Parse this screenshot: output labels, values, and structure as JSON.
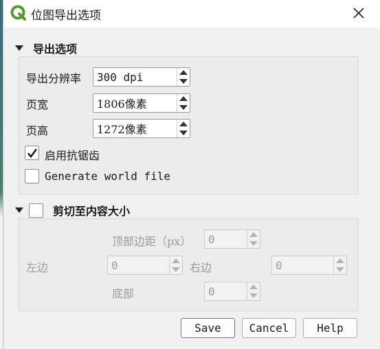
{
  "window": {
    "title": "位图导出选项",
    "close_glyph": "✕"
  },
  "export_options": {
    "header": "导出选项",
    "resolution": {
      "label": "导出分辨率",
      "value": "300 dpi"
    },
    "page_width": {
      "label": "页宽",
      "value": "1806像素"
    },
    "page_height": {
      "label": "页高",
      "value": "1272像素"
    },
    "antialiasing": {
      "label": "启用抗锯齿",
      "checked": true
    },
    "world_file": {
      "label": "Generate world file",
      "checked": false
    }
  },
  "crop": {
    "header": "剪切至内容大小",
    "checked": false,
    "top_margin": {
      "label": "顶部边距（px）",
      "value": "0"
    },
    "left": {
      "label": "左边",
      "value": "0"
    },
    "right": {
      "label": "右边",
      "value": "0"
    },
    "bottom": {
      "label": "底部",
      "value": "0"
    }
  },
  "buttons": {
    "save": "Save",
    "cancel": "Cancel",
    "help": "Help"
  },
  "colors": {
    "accent": "#3a84d6",
    "qgis_green": "#589632",
    "qgis_yellow": "#ee7913"
  }
}
